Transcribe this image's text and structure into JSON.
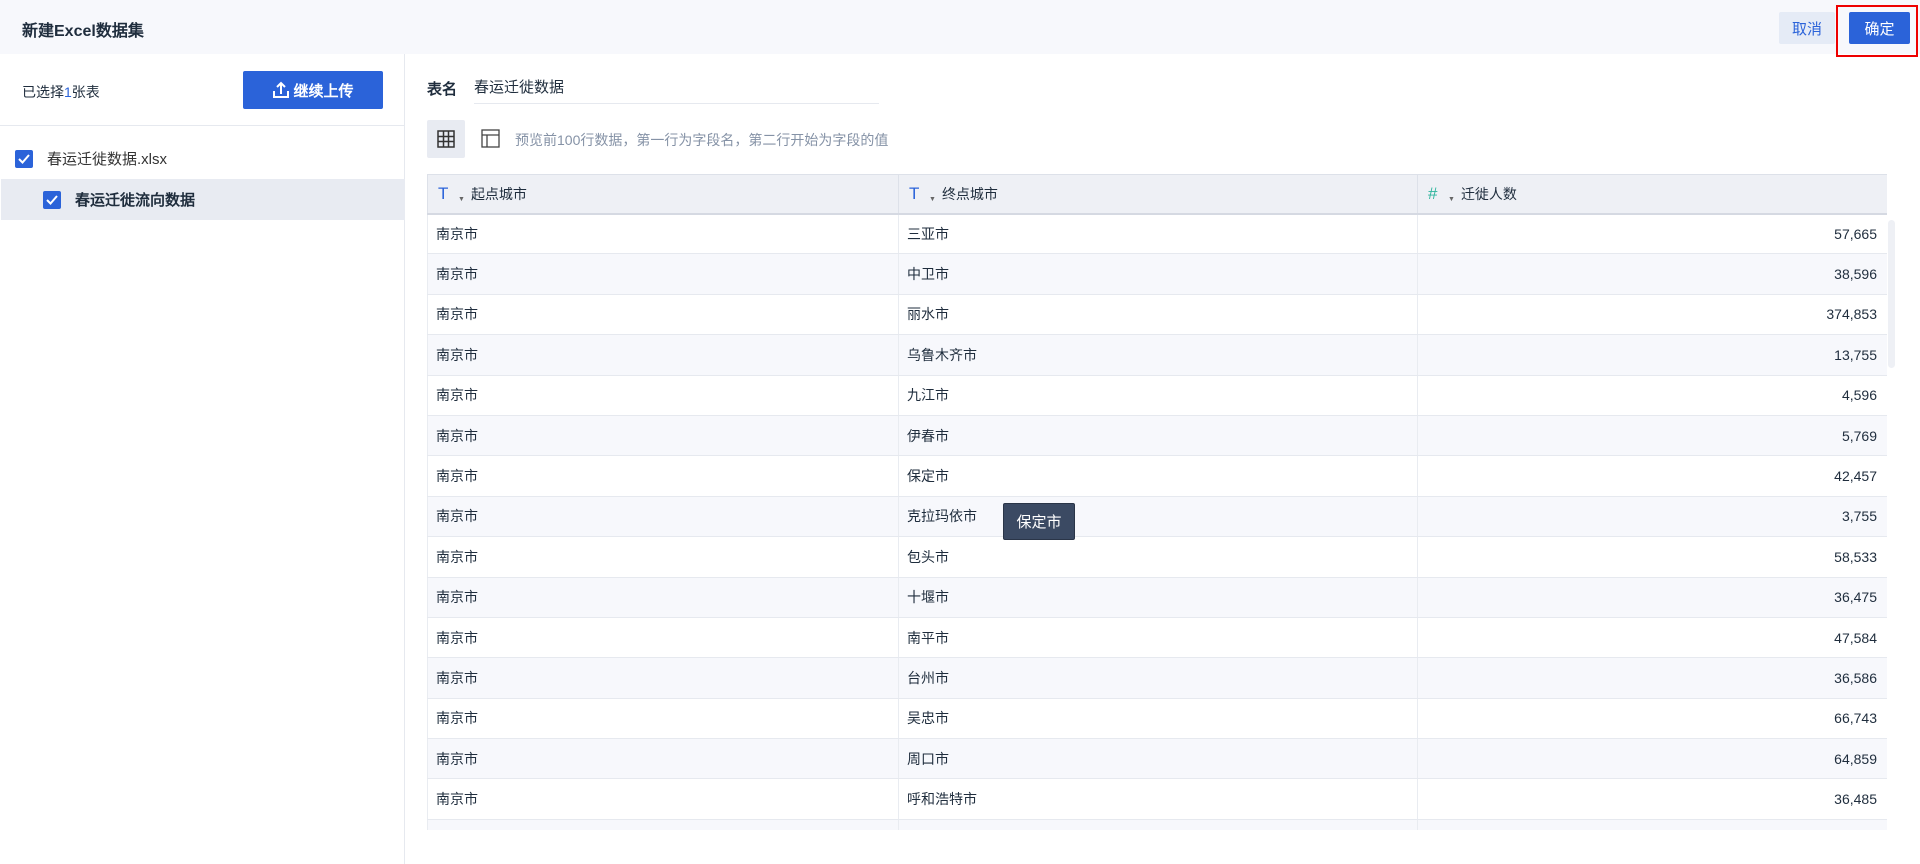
{
  "header": {
    "title": "新建Excel数据集",
    "cancel_label": "取消",
    "confirm_label": "确定"
  },
  "sidebar": {
    "selected_prefix": "已选择",
    "selected_count": "1",
    "selected_suffix": "张表",
    "upload_label": "继续上传",
    "file": {
      "name": "春运迁徙数据.xlsx",
      "checked": true
    },
    "sheet": {
      "name": "春运迁徙流向数据",
      "checked": true
    }
  },
  "main": {
    "name_label": "表名",
    "name_value": "春运迁徙数据",
    "hint": "预览前100行数据，第一行为字段名，第二行开始为字段的值",
    "columns": [
      {
        "label": "起点城市",
        "type": "text-type-icon",
        "glyph": "T"
      },
      {
        "label": "终点城市",
        "type": "text-type-icon",
        "glyph": "T"
      },
      {
        "label": "迁徙人数",
        "type": "number-type-icon",
        "glyph": "#"
      }
    ],
    "rows": [
      [
        "南京市",
        "三亚市",
        "57,665"
      ],
      [
        "南京市",
        "中卫市",
        "38,596"
      ],
      [
        "南京市",
        "丽水市",
        "374,853"
      ],
      [
        "南京市",
        "乌鲁木齐市",
        "13,755"
      ],
      [
        "南京市",
        "九江市",
        "4,596"
      ],
      [
        "南京市",
        "伊春市",
        "5,769"
      ],
      [
        "南京市",
        "保定市",
        "42,457"
      ],
      [
        "南京市",
        "克拉玛依市",
        "3,755"
      ],
      [
        "南京市",
        "包头市",
        "58,533"
      ],
      [
        "南京市",
        "十堰市",
        "36,475"
      ],
      [
        "南京市",
        "南平市",
        "47,584"
      ],
      [
        "南京市",
        "台州市",
        "36,586"
      ],
      [
        "南京市",
        "吴忠市",
        "66,743"
      ],
      [
        "南京市",
        "周口市",
        "64,859"
      ],
      [
        "南京市",
        "呼和浩特市",
        "36,485"
      ],
      [
        "",
        "",
        ""
      ]
    ],
    "tooltip": "保定市"
  },
  "colors": {
    "accent": "#2b63d9",
    "number_icon": "#2fb59d",
    "highlight": "#e00000"
  }
}
